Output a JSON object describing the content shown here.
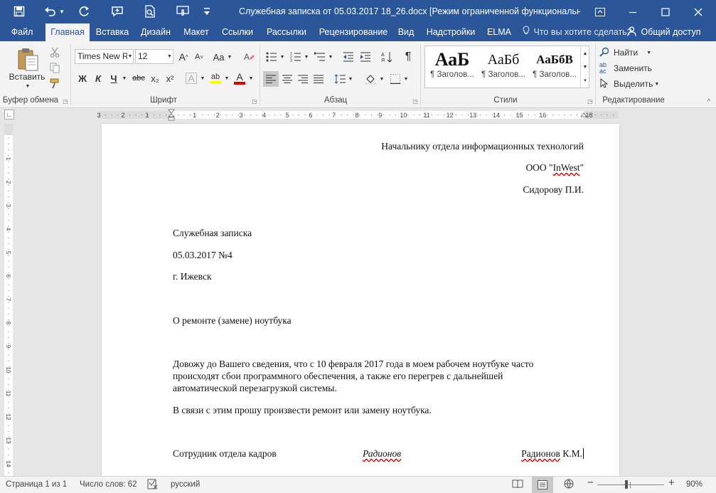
{
  "window": {
    "title": "Служебная записка от 05.03.2017 18_26.docx [Режим ограниченной функциональнос...",
    "accent": "#2b579a"
  },
  "quick_access": [
    "save-icon",
    "undo-icon",
    "redo-icon",
    "comment-icon",
    "print-preview-icon",
    "touch-mode-icon",
    "customize-icon"
  ],
  "tabs": [
    "Файл",
    "Главная",
    "Вставка",
    "Дизайн",
    "Макет",
    "Ссылки",
    "Рассылки",
    "Рецензирование",
    "Вид",
    "Надстройки",
    "ELMA"
  ],
  "active_tab": "Главная",
  "tell_me": "Что вы хотите сделать?",
  "share": "Общий доступ",
  "ribbon": {
    "clipboard": {
      "label": "Буфер обмена",
      "paste": "Вставить"
    },
    "font": {
      "label": "Шрифт",
      "name": "Times New R",
      "size": "12",
      "bold": "Ж",
      "italic": "К",
      "underline": "Ч",
      "strike": "abc",
      "sub": "x₂",
      "sup": "x²",
      "grow": "A",
      "shrink": "A",
      "case": "Aa",
      "effects": "A",
      "highlight": "ab",
      "color": "A"
    },
    "paragraph": {
      "label": "Абзац",
      "pilcrow": "¶"
    },
    "styles": {
      "label": "Стили",
      "items": [
        {
          "preview": "АаБ",
          "name": "¶ Заголов..."
        },
        {
          "preview": "АаБб",
          "name": "¶ Заголов..."
        },
        {
          "preview": "АаБбВ",
          "name": "¶ Заголов..."
        }
      ]
    },
    "editing": {
      "label": "Редактирование",
      "find": "Найти",
      "replace": "Заменить",
      "select": "Выделить"
    }
  },
  "ruler": {
    "left_marks": [
      "3",
      "2",
      "1"
    ],
    "right_marks": [
      "1",
      "2",
      "3",
      "4",
      "5",
      "6",
      "7",
      "8",
      "9",
      "10",
      "11",
      "12",
      "13",
      "14",
      "15",
      "16",
      "18"
    ],
    "vertical_marks": [
      "1",
      "2",
      "3",
      "4",
      "5",
      "6",
      "7",
      "8",
      "9",
      "10",
      "11",
      "12",
      "13",
      "14"
    ]
  },
  "document": {
    "addressee": {
      "line1": "Начальнику отдела информационных технологий",
      "line2_pre": "ООО \"",
      "line2_sq": "InWest",
      "line2_post": "\"",
      "line3": "Сидорову П.И."
    },
    "doc_type": "Служебная записка",
    "date_number": "05.03.2017 №4",
    "city": "г. Ижевск",
    "subject": "О ремонте (замене) ноутбука",
    "body1": [
      "Довожу до Вашего сведения, что с 10 февраля 2017 года в моем рабочем ноутбуке часто",
      "происходят сбои программного обеспечения, а также его перегрев с дальнейшей",
      "автоматической перезагрузкой системы."
    ],
    "body2": "В связи с этим прошу произвести ремонт или замену ноутбука.",
    "signature": {
      "position": "Сотрудник отдела кадров",
      "sign": "Радионов",
      "name_sq": "Радионов",
      "name_rest": " К.М."
    }
  },
  "status": {
    "page": "Страница 1 из 1",
    "words": "Число слов: 62",
    "language": "русский",
    "zoom_minus": "−",
    "zoom_plus": "+",
    "zoom": "90%",
    "zoom_level_percent": 90
  }
}
